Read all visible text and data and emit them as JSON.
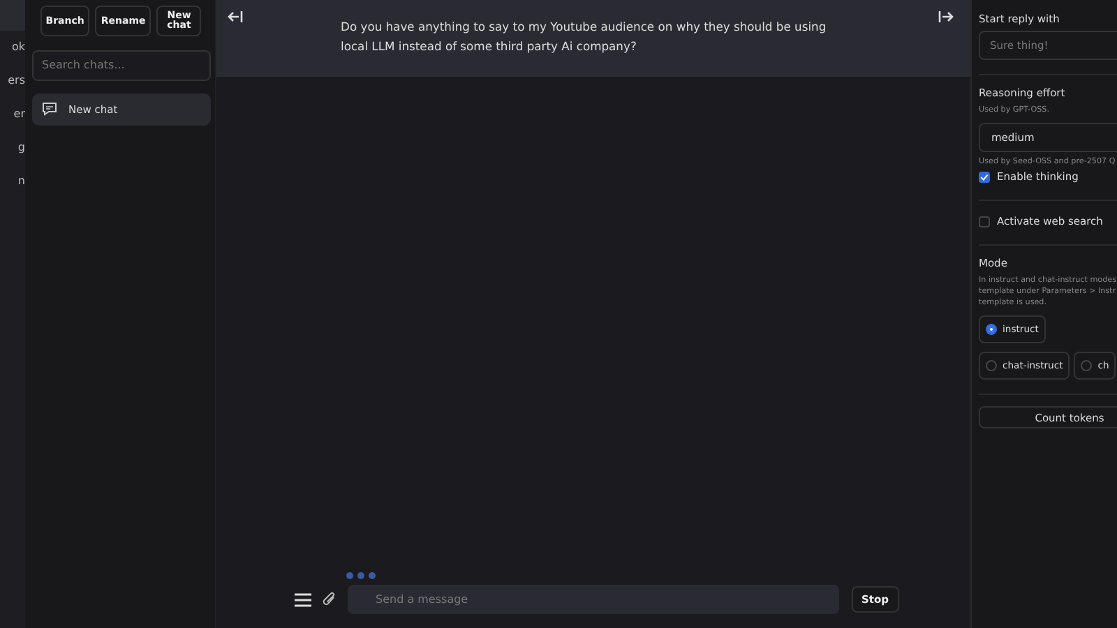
{
  "nav": {
    "items": [
      {
        "label": "ok",
        "selected": false
      },
      {
        "label": "ers",
        "selected": false
      },
      {
        "label": "er",
        "selected": false
      },
      {
        "label": "g",
        "selected": false
      },
      {
        "label": "n",
        "selected": false
      }
    ]
  },
  "sidebar": {
    "buttons": [
      "Branch",
      "Rename",
      "New chat"
    ],
    "search": {
      "placeholder": "Search chats..."
    },
    "chats": [
      {
        "label": "New chat",
        "selected": true
      }
    ]
  },
  "chat": {
    "message": "Do you have anything to say to my Youtube audience on why they should be using local LLM instead of some third party Ai company?",
    "typing": true,
    "input": {
      "placeholder": "Send a message"
    },
    "stop_button": "Stop"
  },
  "settings": {
    "start_reply": {
      "label": "Start reply with",
      "placeholder": "Sure thing!"
    },
    "reasoning": {
      "label": "Reasoning effort",
      "note": "Used by GPT-OSS.",
      "value": "medium",
      "note2": "Used by Seed-OSS and pre-2507 Q"
    },
    "checks": [
      {
        "label": "Enable thinking",
        "checked": true
      },
      {
        "label": "Activate web search",
        "checked": false
      }
    ],
    "mode": {
      "label": "Mode",
      "description": [
        "In instruct and chat-instruct modes",
        "template under Parameters > Instr",
        "template is used."
      ],
      "options": [
        {
          "label": "instruct",
          "selected": true
        },
        {
          "label": "chat-instruct",
          "selected": false
        },
        {
          "label": "ch",
          "selected": false
        }
      ]
    },
    "count_button": "Count tokens"
  }
}
